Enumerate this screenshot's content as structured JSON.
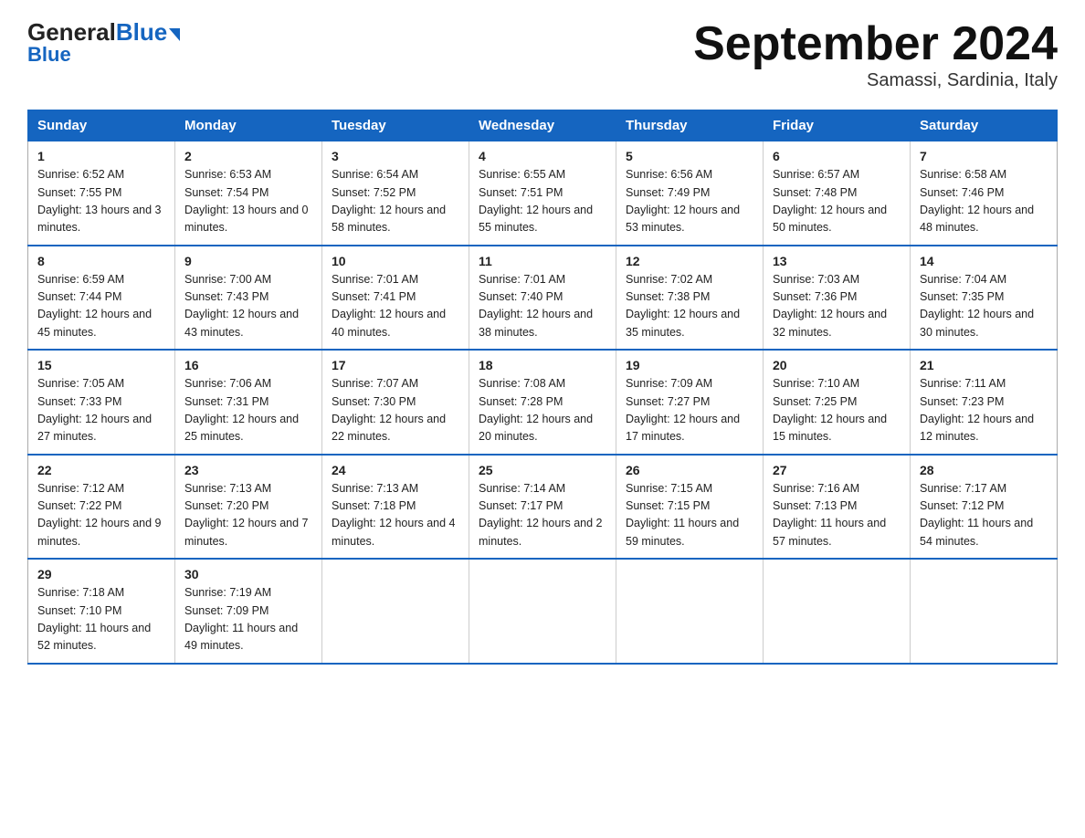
{
  "header": {
    "logo_general": "General",
    "logo_blue": "Blue",
    "title": "September 2024",
    "location": "Samassi, Sardinia, Italy"
  },
  "weekdays": [
    "Sunday",
    "Monday",
    "Tuesday",
    "Wednesday",
    "Thursday",
    "Friday",
    "Saturday"
  ],
  "weeks": [
    [
      {
        "day": "1",
        "sunrise": "6:52 AM",
        "sunset": "7:55 PM",
        "daylight": "13 hours and 3 minutes."
      },
      {
        "day": "2",
        "sunrise": "6:53 AM",
        "sunset": "7:54 PM",
        "daylight": "13 hours and 0 minutes."
      },
      {
        "day": "3",
        "sunrise": "6:54 AM",
        "sunset": "7:52 PM",
        "daylight": "12 hours and 58 minutes."
      },
      {
        "day": "4",
        "sunrise": "6:55 AM",
        "sunset": "7:51 PM",
        "daylight": "12 hours and 55 minutes."
      },
      {
        "day": "5",
        "sunrise": "6:56 AM",
        "sunset": "7:49 PM",
        "daylight": "12 hours and 53 minutes."
      },
      {
        "day": "6",
        "sunrise": "6:57 AM",
        "sunset": "7:48 PM",
        "daylight": "12 hours and 50 minutes."
      },
      {
        "day": "7",
        "sunrise": "6:58 AM",
        "sunset": "7:46 PM",
        "daylight": "12 hours and 48 minutes."
      }
    ],
    [
      {
        "day": "8",
        "sunrise": "6:59 AM",
        "sunset": "7:44 PM",
        "daylight": "12 hours and 45 minutes."
      },
      {
        "day": "9",
        "sunrise": "7:00 AM",
        "sunset": "7:43 PM",
        "daylight": "12 hours and 43 minutes."
      },
      {
        "day": "10",
        "sunrise": "7:01 AM",
        "sunset": "7:41 PM",
        "daylight": "12 hours and 40 minutes."
      },
      {
        "day": "11",
        "sunrise": "7:01 AM",
        "sunset": "7:40 PM",
        "daylight": "12 hours and 38 minutes."
      },
      {
        "day": "12",
        "sunrise": "7:02 AM",
        "sunset": "7:38 PM",
        "daylight": "12 hours and 35 minutes."
      },
      {
        "day": "13",
        "sunrise": "7:03 AM",
        "sunset": "7:36 PM",
        "daylight": "12 hours and 32 minutes."
      },
      {
        "day": "14",
        "sunrise": "7:04 AM",
        "sunset": "7:35 PM",
        "daylight": "12 hours and 30 minutes."
      }
    ],
    [
      {
        "day": "15",
        "sunrise": "7:05 AM",
        "sunset": "7:33 PM",
        "daylight": "12 hours and 27 minutes."
      },
      {
        "day": "16",
        "sunrise": "7:06 AM",
        "sunset": "7:31 PM",
        "daylight": "12 hours and 25 minutes."
      },
      {
        "day": "17",
        "sunrise": "7:07 AM",
        "sunset": "7:30 PM",
        "daylight": "12 hours and 22 minutes."
      },
      {
        "day": "18",
        "sunrise": "7:08 AM",
        "sunset": "7:28 PM",
        "daylight": "12 hours and 20 minutes."
      },
      {
        "day": "19",
        "sunrise": "7:09 AM",
        "sunset": "7:27 PM",
        "daylight": "12 hours and 17 minutes."
      },
      {
        "day": "20",
        "sunrise": "7:10 AM",
        "sunset": "7:25 PM",
        "daylight": "12 hours and 15 minutes."
      },
      {
        "day": "21",
        "sunrise": "7:11 AM",
        "sunset": "7:23 PM",
        "daylight": "12 hours and 12 minutes."
      }
    ],
    [
      {
        "day": "22",
        "sunrise": "7:12 AM",
        "sunset": "7:22 PM",
        "daylight": "12 hours and 9 minutes."
      },
      {
        "day": "23",
        "sunrise": "7:13 AM",
        "sunset": "7:20 PM",
        "daylight": "12 hours and 7 minutes."
      },
      {
        "day": "24",
        "sunrise": "7:13 AM",
        "sunset": "7:18 PM",
        "daylight": "12 hours and 4 minutes."
      },
      {
        "day": "25",
        "sunrise": "7:14 AM",
        "sunset": "7:17 PM",
        "daylight": "12 hours and 2 minutes."
      },
      {
        "day": "26",
        "sunrise": "7:15 AM",
        "sunset": "7:15 PM",
        "daylight": "11 hours and 59 minutes."
      },
      {
        "day": "27",
        "sunrise": "7:16 AM",
        "sunset": "7:13 PM",
        "daylight": "11 hours and 57 minutes."
      },
      {
        "day": "28",
        "sunrise": "7:17 AM",
        "sunset": "7:12 PM",
        "daylight": "11 hours and 54 minutes."
      }
    ],
    [
      {
        "day": "29",
        "sunrise": "7:18 AM",
        "sunset": "7:10 PM",
        "daylight": "11 hours and 52 minutes."
      },
      {
        "day": "30",
        "sunrise": "7:19 AM",
        "sunset": "7:09 PM",
        "daylight": "11 hours and 49 minutes."
      },
      null,
      null,
      null,
      null,
      null
    ]
  ]
}
